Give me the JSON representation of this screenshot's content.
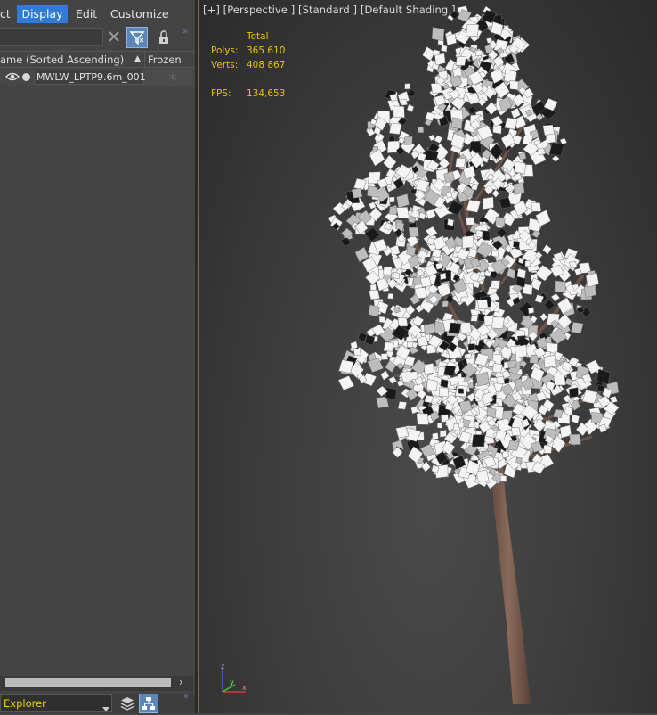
{
  "menu": {
    "items": [
      {
        "label": "ct",
        "active": false
      },
      {
        "label": "Display",
        "active": true
      },
      {
        "label": "Edit",
        "active": false
      },
      {
        "label": "Customize",
        "active": false
      }
    ]
  },
  "toolbar": {
    "clear_icon": "close-icon",
    "filter_icon": "filter-icon",
    "lock_icon": "lock-icon",
    "more_icon": "chevron-double-right-icon"
  },
  "scene_explorer": {
    "columns": {
      "name": "ame (Sorted Ascending)",
      "frozen": "Frozen",
      "sort_indicator": "▲"
    },
    "rows": [
      {
        "name": "MWLW_LPTP9.6m_001",
        "visible": true,
        "frozen": false
      }
    ],
    "footer": {
      "selector_label": "Explorer"
    }
  },
  "viewport": {
    "label": "[+] [Perspective ] [Standard ] [Default Shading ]",
    "stats": {
      "header": "Total",
      "polys_label": "Polys:",
      "polys_value": "365 610",
      "verts_label": "Verts:",
      "verts_value": "408 867",
      "fps_label": "FPS:",
      "fps_value": "134,653"
    },
    "axis": {
      "x": "x",
      "y": "y",
      "z": "z"
    }
  },
  "colors": {
    "accent": "#2f7bd6",
    "stats_text": "#e8c200",
    "viewport_border": "#8a6b3a"
  }
}
